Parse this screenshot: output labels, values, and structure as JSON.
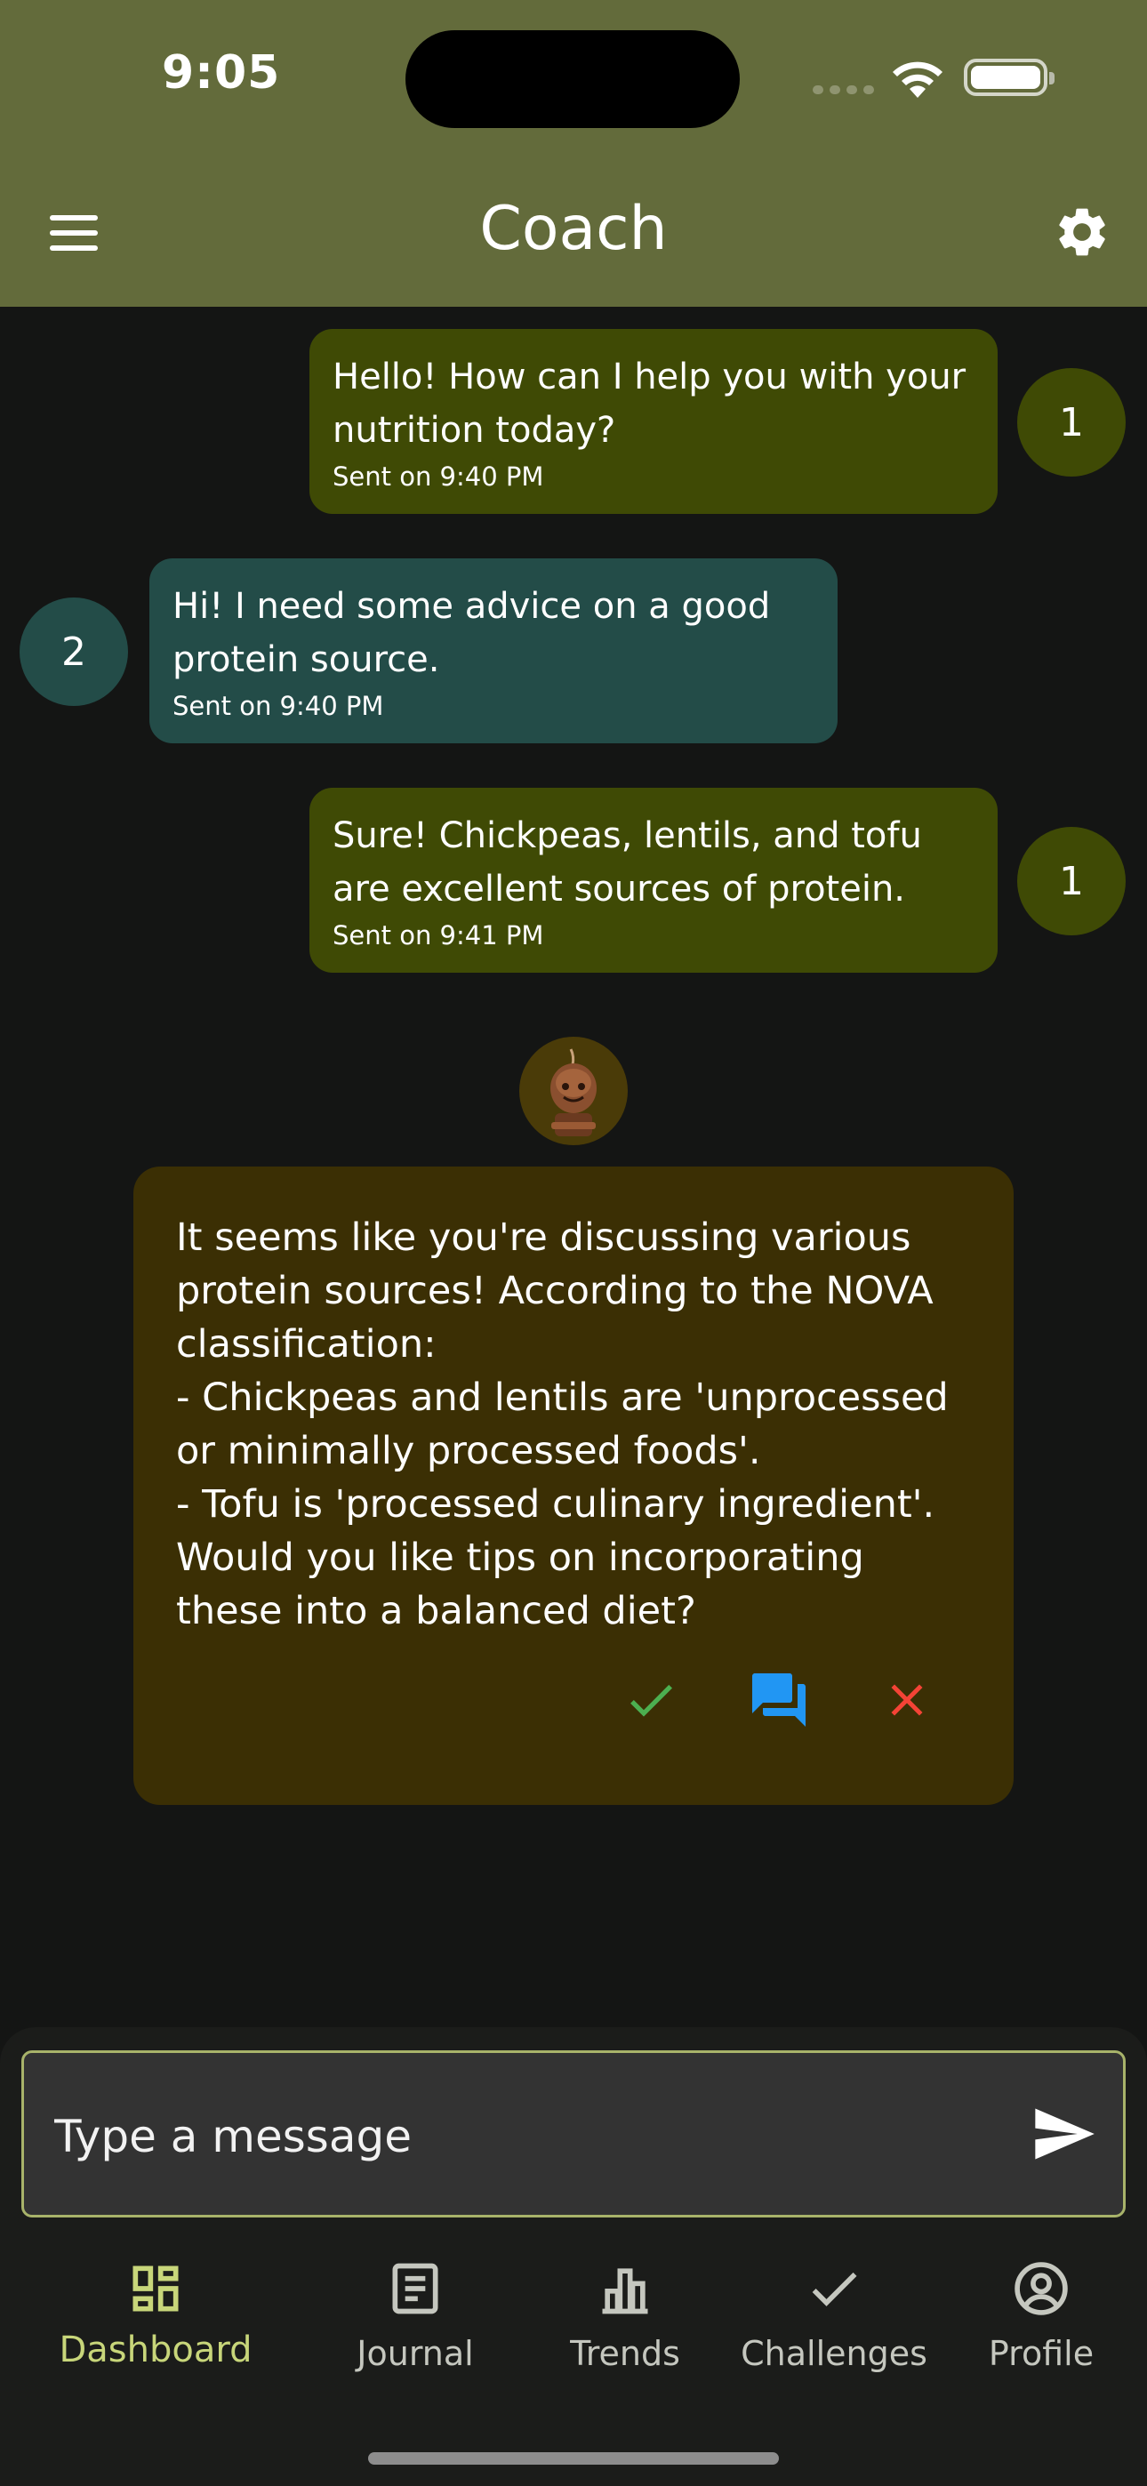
{
  "status_bar": {
    "time": "9:05"
  },
  "header": {
    "title": "Coach",
    "menu_icon": "hamburger-menu-icon",
    "settings_icon": "gear-icon"
  },
  "messages": [
    {
      "sender": "coach",
      "text": "Hello! How can I help you with your nutrition today?",
      "sent": "Sent on 9:40 PM",
      "avatar_label": "1"
    },
    {
      "sender": "user",
      "text": "Hi! I need some advice on a good protein source.",
      "sent": "Sent on 9:40 PM",
      "avatar_label": "2"
    },
    {
      "sender": "coach",
      "text": "Sure! Chickpeas, lentils, and tofu are excellent sources of protein.",
      "sent": "Sent on 9:41 PM",
      "avatar_label": "1"
    }
  ],
  "suggestion": {
    "text": "It seems like you're discussing various protein sources! According to the NOVA classification:\n- Chickpeas and lentils are 'unprocessed or minimally processed foods'.\n- Tofu is 'processed culinary ingredient'. Would you like tips on incorporating these into a balanced diet?",
    "actions": [
      "check-icon",
      "chat-bubbles-icon",
      "close-icon"
    ],
    "colors": {
      "accept": "#4caf50",
      "discuss": "#2196f3",
      "reject": "#f44336"
    }
  },
  "composer": {
    "placeholder": "Type a message",
    "send_icon": "send-icon"
  },
  "bottom_nav": {
    "items": [
      {
        "label": "Dashboard",
        "icon": "dashboard-icon",
        "active": true
      },
      {
        "label": "Journal",
        "icon": "journal-icon",
        "active": false
      },
      {
        "label": "Trends",
        "icon": "bar-chart-icon",
        "active": false
      },
      {
        "label": "Challenges",
        "icon": "check-icon",
        "active": false
      },
      {
        "label": "Profile",
        "icon": "profile-icon",
        "active": false
      }
    ]
  },
  "colors": {
    "header": "#636b3b",
    "coach_bubble": "#3f4a05",
    "user_bubble": "#234c48",
    "suggestion_card": "#3b2f04",
    "active_nav": "#c8d67a"
  }
}
